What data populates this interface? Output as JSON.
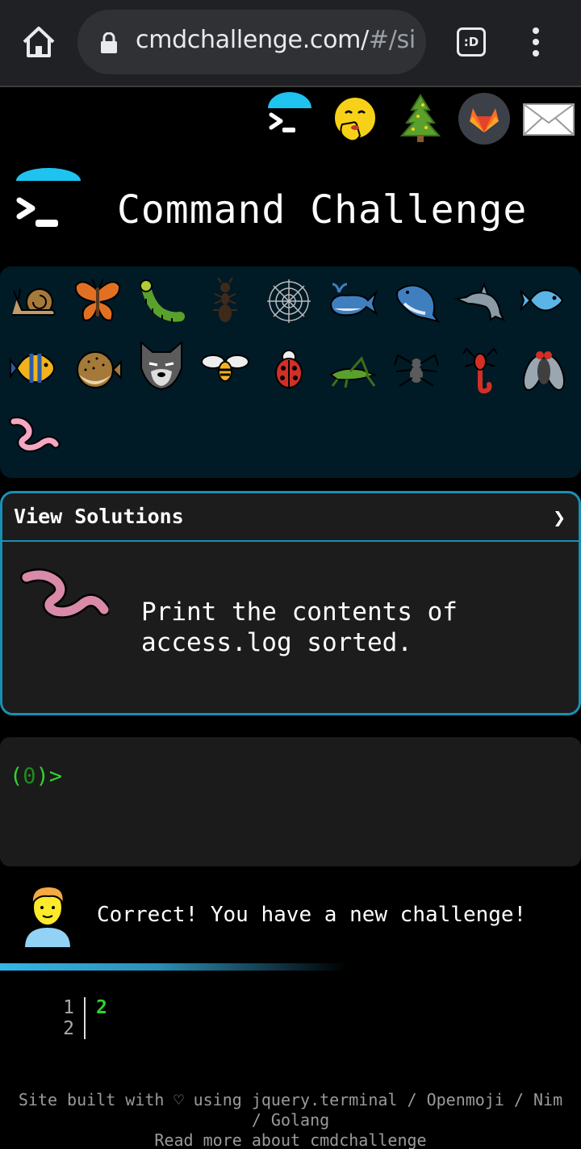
{
  "browser": {
    "url_main": "cmdchallenge.com/",
    "url_dim": "#/si",
    "tabs_label": ":D"
  },
  "header": {
    "title": "Command Challenge"
  },
  "grid": {
    "icons": [
      "snail-icon",
      "butterfly-icon",
      "caterpillar-icon",
      "ant-icon",
      "spider-web-icon",
      "whale-icon",
      "spouting-whale-icon",
      "dolphin-icon",
      "fish-icon",
      "tropical-fish-icon",
      "blowfish-icon",
      "wolf-icon",
      "honeybee-icon",
      "lady-beetle-icon",
      "cricket-icon",
      "spider-icon",
      "scorpion-icon",
      "fly-icon",
      "worm-icon"
    ]
  },
  "card": {
    "header_label": "View Solutions",
    "chevron": "❯",
    "task_line1": "Print the contents of",
    "task_line2": "access.log sorted."
  },
  "terminal": {
    "prompt_open": "(",
    "prompt_num": "0",
    "prompt_close": ")>"
  },
  "feedback": {
    "message": "Correct! You have a new challenge!"
  },
  "output": {
    "line_numbers": [
      "1",
      "2"
    ],
    "value": "2"
  },
  "footer": {
    "line1": "Site built with ♡ using jquery.terminal / Openmoji / Nim",
    "line2": "/ Golang",
    "line3": "Read more about cmdchallenge"
  },
  "colors": {
    "accent": "#1a8fb5",
    "prompt_green": "#2fd42f",
    "grid_bg": "#001a26"
  }
}
